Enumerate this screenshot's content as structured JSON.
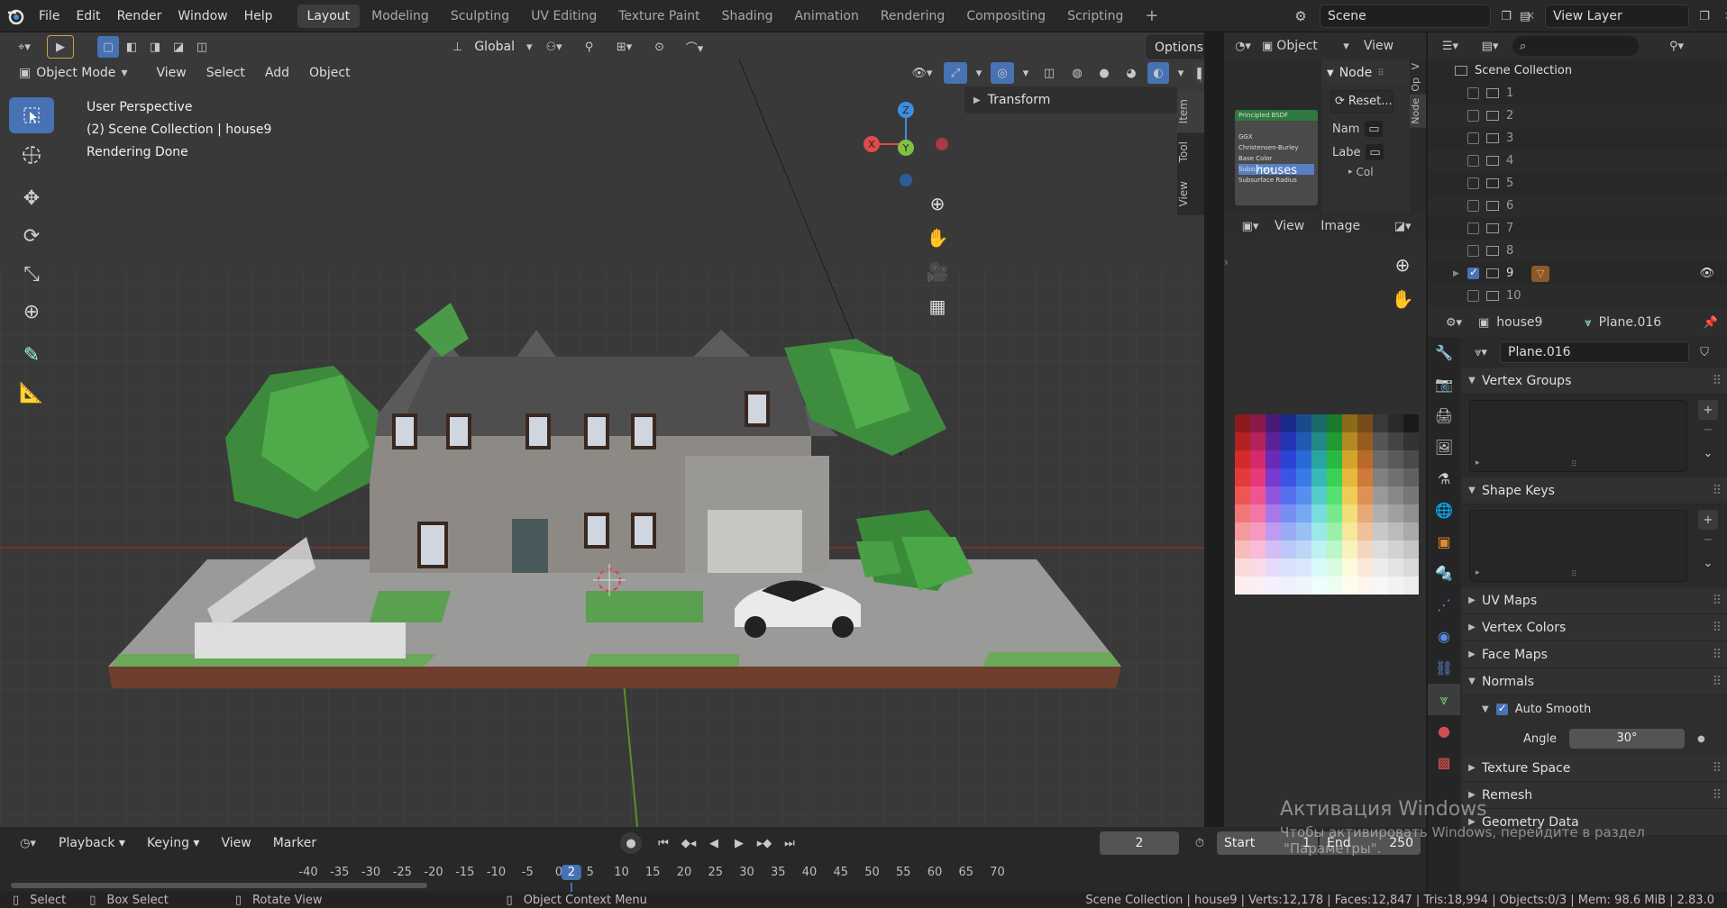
{
  "topbar": {
    "menus": [
      "File",
      "Edit",
      "Render",
      "Window",
      "Help"
    ],
    "workspaces": [
      "Layout",
      "Modeling",
      "Sculpting",
      "UV Editing",
      "Texture Paint",
      "Shading",
      "Animation",
      "Rendering",
      "Compositing",
      "Scripting"
    ],
    "active_workspace": "Layout",
    "add_label": "+",
    "scene_name": "Scene",
    "view_layer": "View Layer"
  },
  "viewport": {
    "header": {
      "orientation": "Global",
      "options_label": "Options",
      "mode": "Object Mode",
      "menus": [
        "View",
        "Select",
        "Add",
        "Object"
      ]
    },
    "overlay_text": {
      "line1": "User Perspective",
      "line2": "(2) Scene Collection | house9",
      "line3": "Rendering Done"
    },
    "gizmo_axes": {
      "x": "X",
      "y": "Y",
      "z": "Z"
    },
    "n_panel": {
      "tabs": [
        "Item",
        "Tool",
        "View"
      ],
      "section": "Transform"
    }
  },
  "node_editor": {
    "mode": "Object",
    "view_label": "View",
    "panel_title": "Node",
    "reset_label": "Reset...",
    "name_label": "Nam",
    "label_label": "Labe",
    "node_title": "Principled BSDF",
    "node_rows": [
      "GGX",
      "Christensen-Burley",
      "Base Color",
      "Subsurface",
      "Subsurface Radius"
    ],
    "overlay_text": "houses",
    "col_label": "Col",
    "side_tabs": [
      "Node",
      "Op",
      "V"
    ]
  },
  "image_editor": {
    "menus": [
      "View",
      "Image"
    ]
  },
  "palette_colors": [
    [
      "#8b1a1a",
      "#8b1a4a",
      "#4a1a7a",
      "#1a2a8b",
      "#1a4a8b",
      "#1a6a6a",
      "#1a7a2a",
      "#8b6a1a",
      "#7a4a1a",
      "#3a3a3a",
      "#2a2a2a",
      "#1a1a1a"
    ],
    [
      "#b32222",
      "#b3225a",
      "#5a2299",
      "#2236b3",
      "#225ab3",
      "#228888",
      "#229933",
      "#b38a22",
      "#995a22",
      "#555555",
      "#444444",
      "#333333"
    ],
    [
      "#d42a2a",
      "#d42a6a",
      "#6a2ab8",
      "#2a44d4",
      "#2a6ad4",
      "#2aa3a3",
      "#2ab844",
      "#d4a32a",
      "#b86a2a",
      "#6a6a6a",
      "#5a5a5a",
      "#4a4a4a"
    ],
    [
      "#e53a3a",
      "#e53a7a",
      "#7a3ad0",
      "#3a55e5",
      "#3a7ae5",
      "#3ab8b8",
      "#3ad055",
      "#e5b83a",
      "#d07a3a",
      "#808080",
      "#707070",
      "#606060"
    ],
    [
      "#ee5555",
      "#ee5590",
      "#9055e0",
      "#5570ee",
      "#5590ee",
      "#55cccc",
      "#55e070",
      "#eecc55",
      "#e09055",
      "#999999",
      "#888888",
      "#777777"
    ],
    [
      "#f27777",
      "#f277a8",
      "#a877e8",
      "#778ef2",
      "#77a8f2",
      "#77dddd",
      "#77e88e",
      "#f2dd77",
      "#e8a877",
      "#b0b0b0",
      "#a0a0a0",
      "#909090"
    ],
    [
      "#f59a9a",
      "#f59ac0",
      "#c09af0",
      "#9aaaf5",
      "#9ac0f5",
      "#9ae8e8",
      "#9af0aa",
      "#f5e89a",
      "#f0c09a",
      "#c8c8c8",
      "#bbbbbb",
      "#aaaaaa"
    ],
    [
      "#f8bcbc",
      "#f8bcd6",
      "#d6bcf5",
      "#bcc8f8",
      "#bcd6f8",
      "#bcf2f2",
      "#bcf5c8",
      "#f8f2bc",
      "#f5d6bc",
      "#dddddd",
      "#d2d2d2",
      "#c6c6c6"
    ],
    [
      "#fbdada",
      "#fbdae8",
      "#e8dafa",
      "#dae2fb",
      "#dae8fb",
      "#dafafa",
      "#dafae2",
      "#fbfada",
      "#fae8da",
      "#ececec",
      "#e4e4e4",
      "#dadada"
    ],
    [
      "#fdeeee",
      "#fdeef5",
      "#f5eefd",
      "#eef1fd",
      "#eef5fd",
      "#eefdfd",
      "#eefdf1",
      "#fdfdee",
      "#fdf5ee",
      "#f7f7f7",
      "#f2f2f2",
      "#ededed"
    ]
  ],
  "outliner": {
    "root": "Scene Collection",
    "collections": [
      "1",
      "2",
      "3",
      "4",
      "5",
      "6",
      "7",
      "8",
      "9",
      "10"
    ],
    "checked_index": 8
  },
  "properties": {
    "object_name": "house9",
    "mesh_name": "Plane.016",
    "data_field": "Plane.016",
    "sections": {
      "vertex_groups": "Vertex Groups",
      "shape_keys": "Shape Keys",
      "uv_maps": "UV Maps",
      "vertex_colors": "Vertex Colors",
      "face_maps": "Face Maps",
      "normals": "Normals",
      "auto_smooth": "Auto Smooth",
      "angle_label": "Angle",
      "angle_value": "30°",
      "texture_space": "Texture Space",
      "remesh": "Remesh",
      "geometry_data": "Geometry Data"
    }
  },
  "watermark": {
    "title": "Активация Windows",
    "subtitle": "Чтобы активировать Windows, перейдите в раздел",
    "subtitle2": "\"Параметры\"."
  },
  "timeline": {
    "menus": [
      "Playback",
      "Keying",
      "View",
      "Marker"
    ],
    "current_frame": "2",
    "start_label": "Start",
    "start_value": "1",
    "end_label": "End",
    "end_value": "250",
    "ruler": [
      "-40",
      "-35",
      "-30",
      "-25",
      "-20",
      "-15",
      "-10",
      "-5",
      "0",
      "2",
      "5",
      "10",
      "15",
      "20",
      "25",
      "30",
      "35",
      "40",
      "45",
      "50",
      "55",
      "60",
      "65",
      "70"
    ]
  },
  "statusbar": {
    "select": "Select",
    "box_select": "Box Select",
    "rotate_view": "Rotate View",
    "context_menu": "Object Context Menu",
    "stats": "Scene Collection | house9 | Verts:12,178 | Faces:12,847 | Tris:18,994 | Objects:0/3 | Mem: 98.6 MiB | 2.83.0"
  }
}
